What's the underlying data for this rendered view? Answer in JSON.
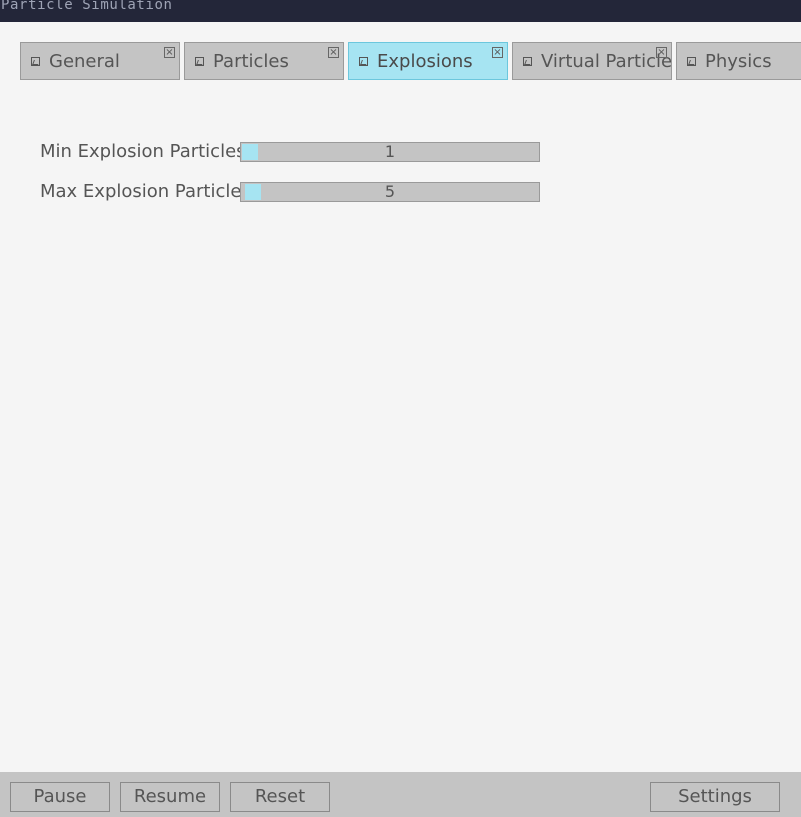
{
  "window": {
    "title": "Particle Simulation"
  },
  "tabs": [
    {
      "label": "General",
      "active": false
    },
    {
      "label": "Particles",
      "active": false
    },
    {
      "label": "Explosions",
      "active": true
    },
    {
      "label": "Virtual Particles",
      "active": false
    },
    {
      "label": "Physics",
      "active": false
    }
  ],
  "settings": {
    "min_explosion": {
      "label": "Min Explosion Particles",
      "value": "1"
    },
    "max_explosion": {
      "label": "Max Explosion Particles",
      "value": "5"
    }
  },
  "toolbar": {
    "pause": "Pause",
    "resume": "Resume",
    "reset": "Reset",
    "settings": "Settings"
  },
  "icons": {
    "tab": "image-icon",
    "close": "close-icon"
  },
  "colors": {
    "titlebar": "#232639",
    "accent": "#a6e4f2",
    "panel": "#c4c4c4",
    "background": "#f5f5f5"
  }
}
